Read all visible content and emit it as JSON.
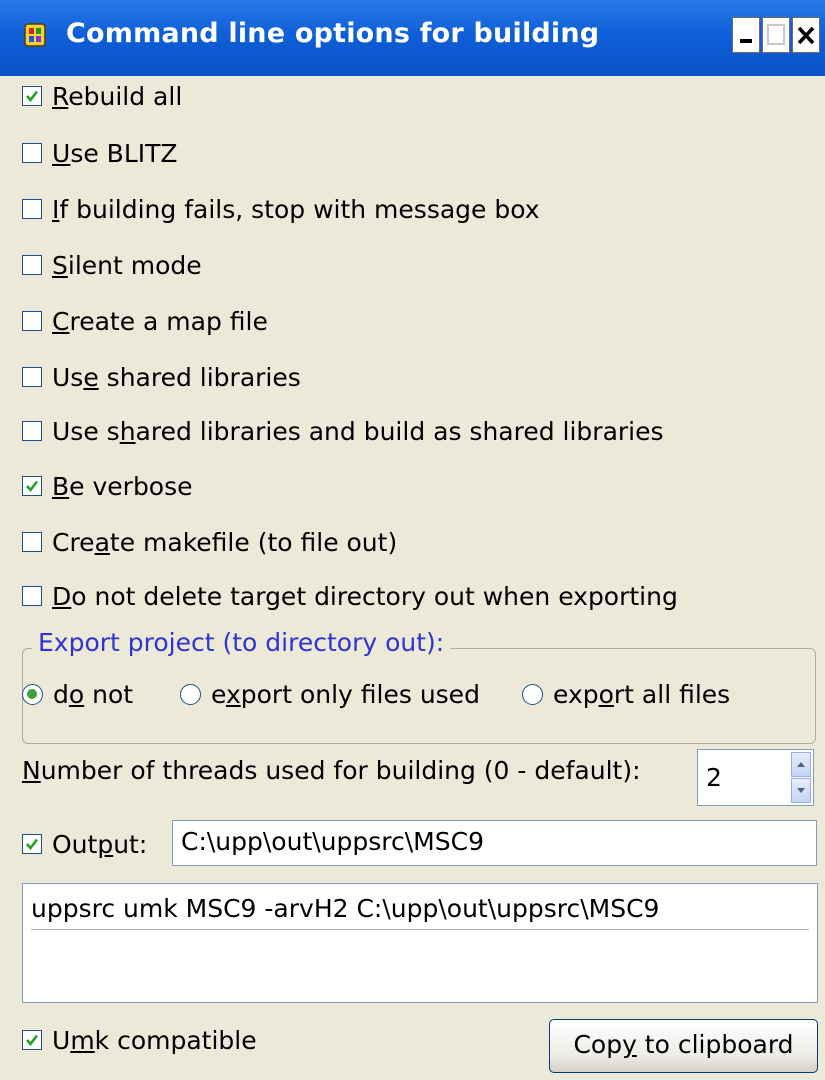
{
  "window": {
    "title": "Command line options for building"
  },
  "options": {
    "rebuild_all": {
      "pre": "",
      "key": "R",
      "post": "ebuild all",
      "checked": true
    },
    "use_blitz": {
      "pre": "",
      "key": "U",
      "post": "se BLITZ",
      "checked": false
    },
    "stop_message": {
      "pre": "",
      "key": "I",
      "post": "f building fails, stop with message box",
      "checked": false
    },
    "silent": {
      "pre": "",
      "key": "S",
      "post": "ilent mode",
      "checked": false
    },
    "map_file": {
      "pre": "",
      "key": "C",
      "post": "reate a map file",
      "checked": false
    },
    "shared_libs": {
      "pre": "Us",
      "key": "e",
      "post": " shared libraries",
      "checked": false
    },
    "shared_build": {
      "pre": "Use s",
      "key": "h",
      "post": "ared libraries and build as shared libraries",
      "checked": false
    },
    "verbose": {
      "pre": "",
      "key": "B",
      "post": "e verbose",
      "checked": true
    },
    "makefile": {
      "pre": "Cre",
      "key": "a",
      "post": "te makefile (to file out)",
      "checked": false
    },
    "no_delete": {
      "pre": "",
      "key": "D",
      "post": "o not delete target directory out when exporting",
      "checked": false
    }
  },
  "export": {
    "legend": "Export project (to directory out):",
    "do_not": {
      "pre": "d",
      "key": "o",
      "post": " not",
      "selected": true
    },
    "used_files": {
      "pre": "e",
      "key": "x",
      "post": "port only files used",
      "selected": false
    },
    "all_files": {
      "pre": "exp",
      "key": "o",
      "post": "rt all files",
      "selected": false
    }
  },
  "threads": {
    "key": "N",
    "label_rest": "umber of threads used for building (0 - default):",
    "value": "2"
  },
  "output": {
    "pre": "Out",
    "key": "p",
    "post": "ut:",
    "checked": true,
    "path": "C:\\upp\\out\\uppsrc\\MSC9"
  },
  "command": "uppsrc umk MSC9 -arvH2 C:\\upp\\out\\uppsrc\\MSC9",
  "umk": {
    "pre": "U",
    "key": "m",
    "post": "k compatible",
    "checked": true
  },
  "copy_button": {
    "pre": "Cop",
    "key": "y",
    "post": " to clipboard"
  },
  "colors": {
    "titlebar": "#0a52c7",
    "dialog_bg": "#ece9d8",
    "legend_text": "#2f34d1",
    "check_mark": "#21a121"
  },
  "icons": [
    "app-icon",
    "minimize-icon",
    "maximize-icon",
    "close-icon",
    "check-icon",
    "spin-up-icon",
    "spin-down-icon"
  ]
}
